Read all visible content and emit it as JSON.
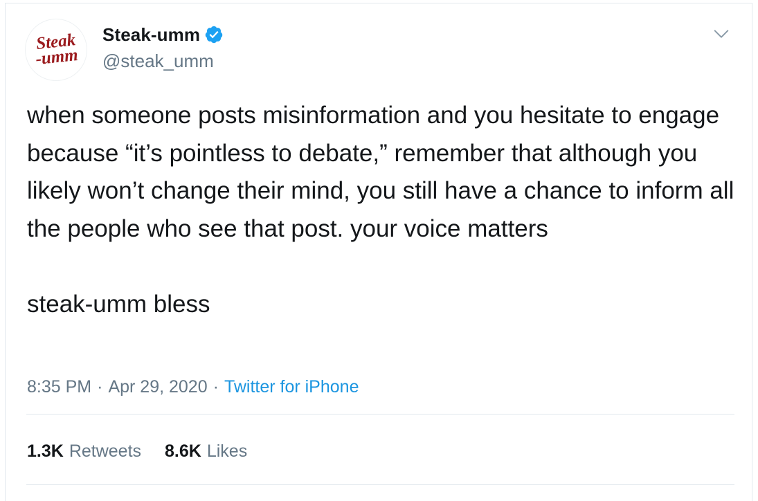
{
  "tweet": {
    "author": {
      "avatar_logo_line1": "Steak",
      "avatar_logo_line2": "-umm",
      "display_name": "Steak-umm",
      "handle": "@steak_umm",
      "verified": true
    },
    "text_paragraphs": [
      "when someone posts misinformation and you hesitate to engage because “it’s pointless to debate,” remember that although you likely won’t change their mind, you still have a chance to inform all the people who see that post. your voice matters",
      "steak-umm bless"
    ],
    "meta": {
      "time": "8:35 PM",
      "separator": "·",
      "date": "Apr 29, 2020",
      "source": "Twitter for iPhone"
    },
    "stats": {
      "retweets_count": "1.3K",
      "retweets_label": "Retweets",
      "likes_count": "8.6K",
      "likes_label": "Likes"
    }
  },
  "icons": {
    "verified": "verified-badge-icon",
    "caret": "chevron-down-icon"
  },
  "colors": {
    "text_primary": "#14171a",
    "text_secondary": "#657786",
    "link": "#1b95e0",
    "verified": "#1da1f2",
    "logo_red": "#9b1b1e",
    "divider": "#e1e8ed"
  }
}
